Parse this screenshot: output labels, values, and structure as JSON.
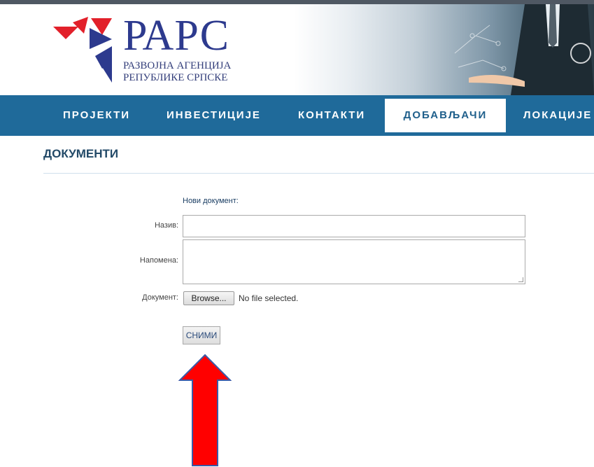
{
  "header": {
    "logo_title": "РАРС",
    "logo_line1": "РАЗВОЈНА АГЕНЦИЈА",
    "logo_line2": "РЕПУБЛИКЕ СРПСКЕ"
  },
  "nav": {
    "items": [
      {
        "label": "ПРОЈЕКТИ"
      },
      {
        "label": "ИНВЕСТИЦИЈЕ"
      },
      {
        "label": "КОНТАКТИ"
      },
      {
        "label": "ДОБАВЉАЧИ",
        "active": true
      },
      {
        "label": "ЛОКАЦИЈЕ"
      }
    ]
  },
  "page": {
    "title": "ДОКУМЕНТИ"
  },
  "form": {
    "header": "Нови документ:",
    "name_label": "Назив:",
    "name_value": "",
    "note_label": "Напомена:",
    "note_value": "",
    "doc_label": "Документ:",
    "browse_label": "Browse...",
    "file_status": "No file selected.",
    "save_label": "СНИМИ"
  },
  "colors": {
    "navbar": "#1f6a9a",
    "logo_blue": "#2d3a8e",
    "logo_red": "#e2202a",
    "arrow": "#ff0000"
  }
}
